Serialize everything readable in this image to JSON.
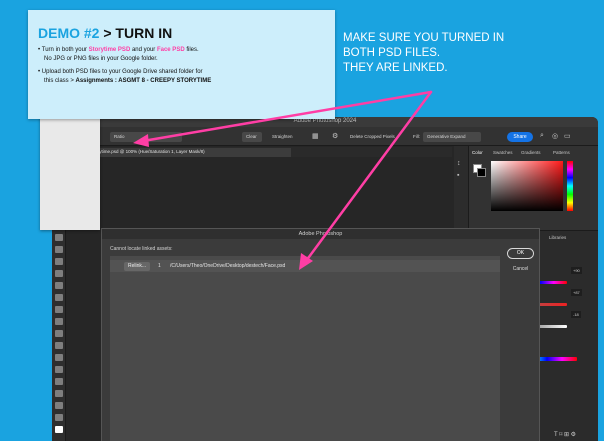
{
  "colors": {
    "background": "#1aa3e0",
    "accent_pink": "#ff3ea5",
    "card": "#cdeefb",
    "ps_dark": "#262626",
    "share_blue": "#1473e6"
  },
  "card": {
    "title_demo": "DEMO #2",
    "title_rest": " > TURN IN",
    "bullet1_pre": "Turn in both your ",
    "bullet1_storytime": "Storytime PSD",
    "bullet1_mid": " and your ",
    "bullet1_face": "Face PSD",
    "bullet1_post": " files.",
    "bullet1_line2": "No JPG or PNG files in your Google folder.",
    "bullet2_line1": "Upload both PSD files to your Google Drive shared folder for",
    "bullet2_line2_pre": "this class > ",
    "bullet2_line2_bold": "Assignments : ASGMT 8 - CREEPY STORYTIME"
  },
  "annotation": {
    "line1": "MAKE SURE YOU TURNED IN",
    "line2": "BOTH PSD FILES.",
    "line3": "THEY ARE LINKED."
  },
  "photoshop": {
    "window_title": "Adobe Photoshop 2024",
    "options": {
      "preset": "Ratio",
      "clear": "Clear",
      "straighten": "Straighten",
      "delete_cropped": "Delete Cropped Pixels",
      "fill_label": "Fill:",
      "fill_value": "Generative Expand",
      "share": "Share"
    },
    "doc_tab": "ASGMT8_Storytime.psd @ 100% (Hue/Saturation 1, Layer Mask/8)",
    "panels": {
      "tabs": [
        "Color",
        "Swatches",
        "Gradients",
        "Patterns"
      ],
      "tabs2": [
        "Properties",
        "Adjustments",
        "Libraries"
      ],
      "values": [
        "+90",
        "+87",
        "-18"
      ]
    },
    "dialog": {
      "title": "Adobe Photoshop",
      "message": "Cannot locate linked assets:",
      "relink_label": "Relink...",
      "row_number": "1",
      "path": "/C/Users/Theo/OneDrive/Desktop/destech/Face.psd",
      "ok_label": "OK",
      "cancel_label": "Cancel"
    }
  }
}
